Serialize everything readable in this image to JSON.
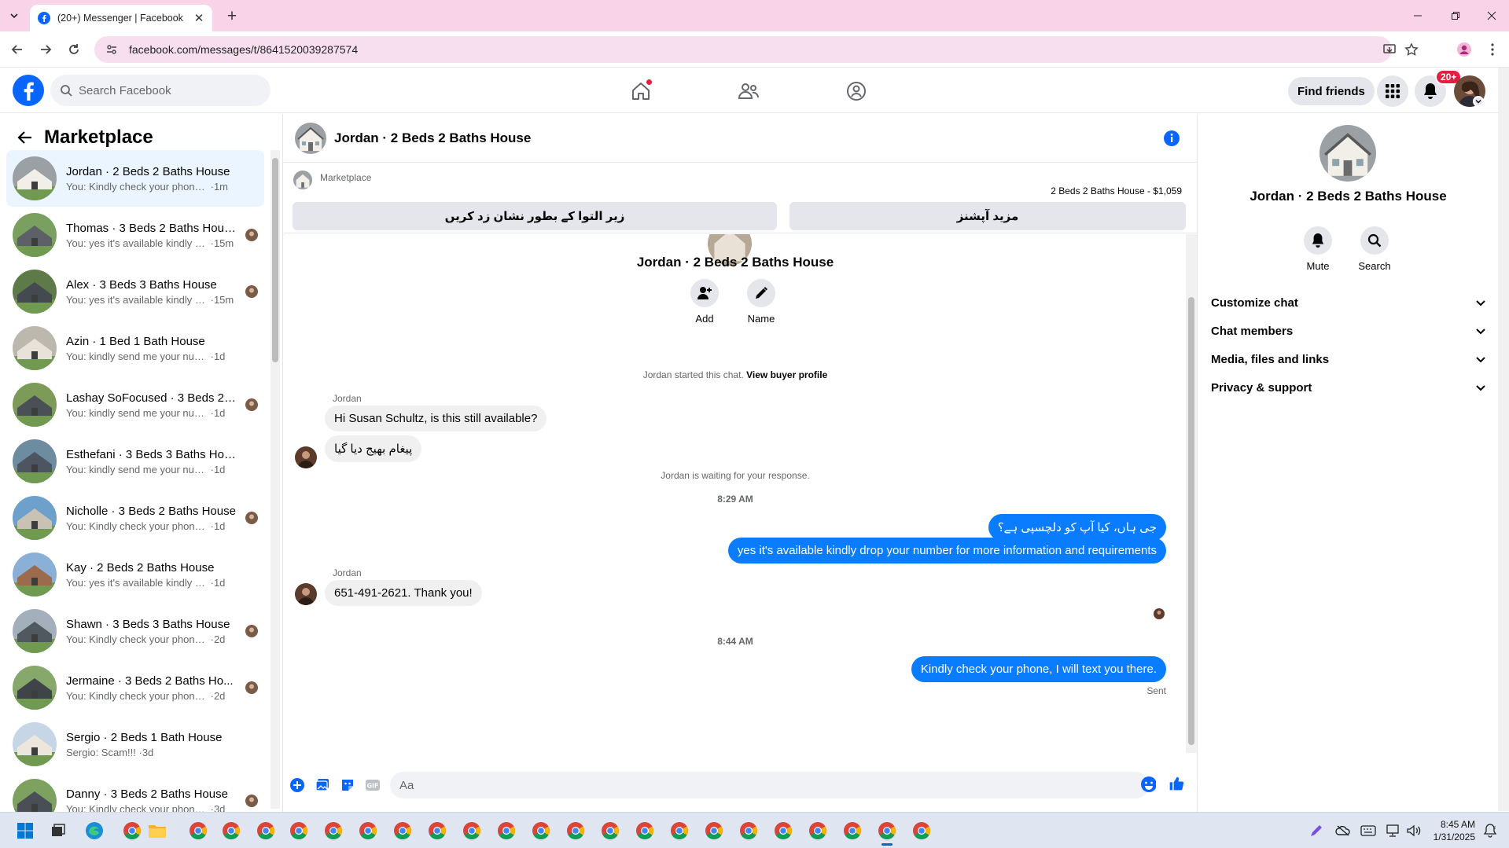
{
  "browser": {
    "tab_title": "(20+) Messenger | Facebook",
    "url": "facebook.com/messages/t/8641520039287574"
  },
  "fb": {
    "search_placeholder": "Search Facebook",
    "find_friends": "Find friends",
    "notif_badge": "20+"
  },
  "left": {
    "title": "Marketplace",
    "conversations": [
      {
        "name": "Jordan · 2 Beds 2 Baths House",
        "preview": "You: Kindly check your phone, I wi...",
        "time": "1m",
        "active": true
      },
      {
        "name": "Thomas · 3 Beds 2 Baths House",
        "preview": "You: yes it's available kindly dr...",
        "time": "15m"
      },
      {
        "name": "Alex · 3 Beds 3 Baths House",
        "preview": "You: yes it's available kindly drop...",
        "time": "15m"
      },
      {
        "name": "Azin · 1 Bed 1 Bath House",
        "preview": "You: kindly send me your numb...",
        "time": "1d"
      },
      {
        "name": "Lashay SoFocused · 3 Beds 2 ...",
        "preview": "You: kindly send me your numb...",
        "time": "1d"
      },
      {
        "name": "Esthefani · 3 Beds 3 Baths House",
        "preview": "You: kindly send me your number f...",
        "time": "1d"
      },
      {
        "name": "Nicholle · 3 Beds 2 Baths House",
        "preview": "You: Kindly check your phone, I ...",
        "time": "1d"
      },
      {
        "name": "Kay · 2 Beds 2 Baths House",
        "preview": "You: yes it's available kindly drop y...",
        "time": "1d"
      },
      {
        "name": "Shawn · 3 Beds 3 Baths House",
        "preview": "You: Kindly check your phone, I ...",
        "time": "2d"
      },
      {
        "name": "Jermaine · 3 Beds 2 Baths Ho...",
        "preview": "You: Kindly check your phone, I ...",
        "time": "2d"
      },
      {
        "name": "Sergio · 2 Beds 1 Bath House",
        "preview": "Sergio: Scam!!!",
        "time": "3d"
      },
      {
        "name": "Danny · 3 Beds 2 Baths House",
        "preview": "You: Kindly check your phone, I ...",
        "time": "3d"
      }
    ]
  },
  "chat": {
    "title": "Jordan · 2 Beds 2 Baths House",
    "marketplace_label": "Marketplace",
    "listing_price": "2 Beds 2 Baths House - $1,059",
    "btn_mark": "زیر التوا کے بطور نشان زد کریں",
    "btn_more": "مزید آپشنز",
    "intro_name": "Jordan · 2 Beds 2 Baths House",
    "act_add": "Add",
    "act_name": "Name",
    "started_text": "Jordan started this chat.",
    "view_buyer": "View buyer profile",
    "sender1": "Jordan",
    "msg1": "Hi Susan Schultz, is this still available?",
    "msg2": "پیغام بھیج دیا گیا",
    "waiting": "Jordan is waiting for your response.",
    "time1": "8:29 AM",
    "out1": "جی ہاں، کیا آپ کو دلچسپی ہے؟",
    "out2": "yes it's available kindly drop your number for more information and requirements",
    "sender2": "Jordan",
    "msg3": "651-491-2621. Thank you!",
    "time2": "8:44 AM",
    "out3": "Kindly check your phone, I will text you there.",
    "sent": "Sent",
    "composer_placeholder": "Aa"
  },
  "right": {
    "name": "Jordan · 2 Beds 2 Baths House",
    "mute": "Mute",
    "search": "Search",
    "sections": [
      "Customize chat",
      "Chat members",
      "Media, files and links",
      "Privacy & support"
    ]
  },
  "taskbar": {
    "time": "8:45 AM",
    "date": "1/31/2025"
  },
  "colors": {
    "fb_blue": "#0866ff",
    "outgoing_bubble": "#0a7cff",
    "active_row": "#ebf5ff",
    "tabstrip": "#f9d4e9"
  }
}
